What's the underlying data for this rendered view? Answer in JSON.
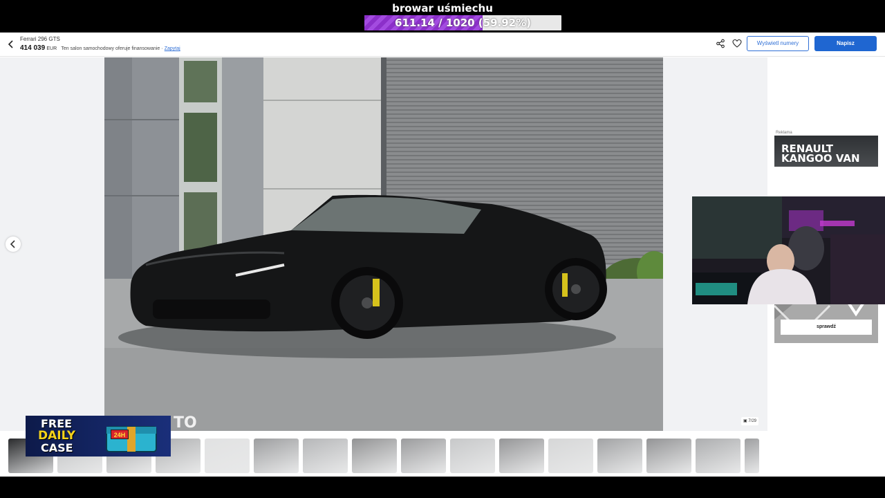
{
  "stream_overlay": {
    "goal_title": "browar uśmiechu",
    "goal_progress_text": "611.14 / 1020 (59.92%)",
    "goal_fraction": 0.5992,
    "fill_color": "#8b2fc9"
  },
  "header": {
    "listing_name": "Ferrari 296 GTS",
    "price_value": "414 039",
    "price_currency": "EUR",
    "financing_text": "Ten salon samochodowy oferuje finansowanie ·",
    "financing_link": "Zapytaj",
    "show_numbers_label": "Wyświetl numery",
    "write_label": "Napisz",
    "share_icon": "share-icon",
    "favorite_icon": "heart-icon",
    "accent_color": "#1f66d1"
  },
  "gallery": {
    "photo_counter": "7/29",
    "current_photo": 7,
    "total_photos": 29,
    "watermark": "TO"
  },
  "ad": {
    "label": "Reklama",
    "headline": "RENAULT KANGOO VAN",
    "cta": "sprawdź"
  },
  "case_banner": {
    "line1": "FREE",
    "line2": "DAILY",
    "line3": "CASE",
    "badge": "24H"
  }
}
